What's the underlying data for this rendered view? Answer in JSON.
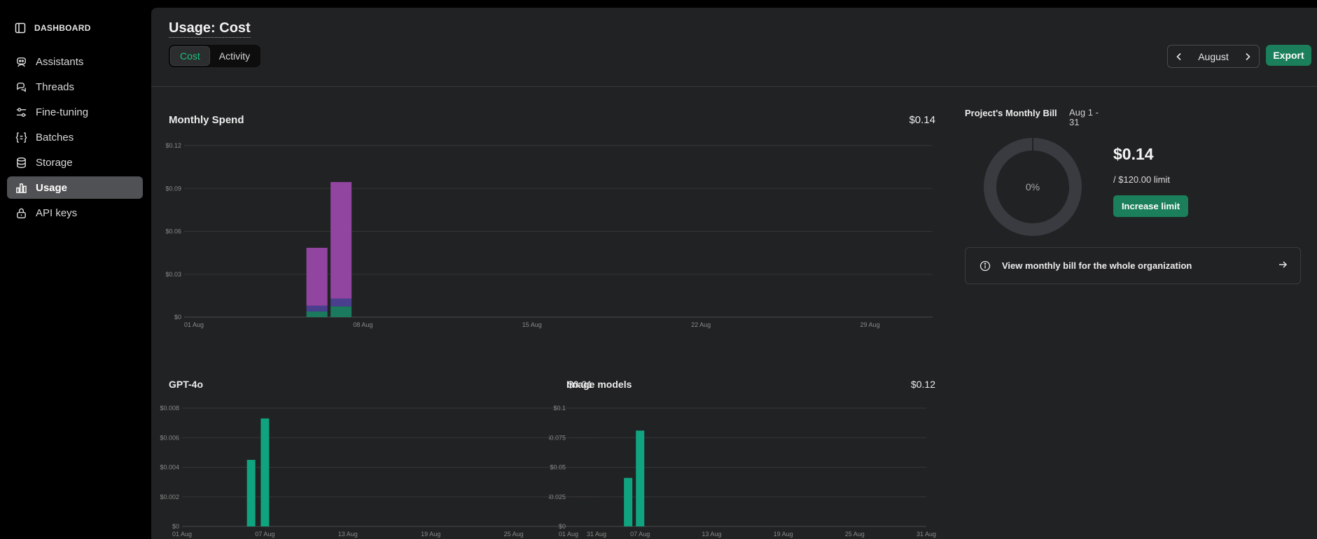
{
  "sidebar": {
    "brand": "DASHBOARD",
    "items": [
      {
        "label": "Assistants",
        "icon": "assistant-icon"
      },
      {
        "label": "Threads",
        "icon": "threads-icon"
      },
      {
        "label": "Fine-tuning",
        "icon": "sliders-icon"
      },
      {
        "label": "Batches",
        "icon": "batches-icon"
      },
      {
        "label": "Storage",
        "icon": "database-icon"
      },
      {
        "label": "Usage",
        "icon": "bar-chart-icon",
        "active": true
      },
      {
        "label": "API keys",
        "icon": "lock-icon"
      }
    ]
  },
  "header": {
    "title": "Usage: Cost",
    "tabs": [
      {
        "label": "Cost",
        "active": true
      },
      {
        "label": "Activity"
      }
    ],
    "month": "August",
    "export_label": "Export"
  },
  "monthly_spend": {
    "title": "Monthly Spend",
    "total": "$0.14"
  },
  "gpt4o": {
    "title": "GPT-4o",
    "total": "$0.01"
  },
  "image_models": {
    "title": "Image models",
    "total": "$0.12"
  },
  "bill": {
    "title": "Project's Monthly Bill",
    "range": "Aug 1 - 31",
    "percent_label": "0%",
    "amount": "$0.14",
    "limit": "/ $120.00 limit",
    "increase_label": "Increase limit",
    "org_link": "View monthly bill for the whole organization"
  },
  "colors": {
    "accent": "#19c37d",
    "button_green": "#1a7f5a",
    "purple": "#9245a0",
    "indigo": "#4a3f8f",
    "teal": "#1b7a5e"
  },
  "chart_data": [
    {
      "type": "bar",
      "title": "Monthly Spend",
      "stacked": true,
      "yticks": [
        "$0",
        "$0.03",
        "$0.06",
        "$0.09",
        "$0.12"
      ],
      "ylim": [
        0,
        0.12
      ],
      "xticks": [
        "01 Aug",
        "08 Aug",
        "15 Aug",
        "22 Aug",
        "29 Aug"
      ],
      "xlim": [
        1,
        32
      ],
      "bars": [
        {
          "day": 6.5,
          "segments": [
            {
              "value": 0.004,
              "color": "#1b7a5e"
            },
            {
              "value": 0.004,
              "color": "#4a3f8f"
            },
            {
              "value": 0.0405,
              "color": "#9245a0"
            }
          ]
        },
        {
          "day": 7.5,
          "segments": [
            {
              "value": 0.0075,
              "color": "#1b7a5e"
            },
            {
              "value": 0.0055,
              "color": "#4a3f8f"
            },
            {
              "value": 0.0815,
              "color": "#9245a0"
            }
          ]
        }
      ]
    },
    {
      "type": "bar",
      "title": "GPT-4o",
      "yticks": [
        "$0",
        "$0.002",
        "$0.004",
        "$0.006",
        "$0.008"
      ],
      "ylim": [
        0,
        0.008
      ],
      "xticks": [
        "01 Aug",
        "07 Aug",
        "13 Aug",
        "19 Aug",
        "25 Aug",
        "31 Aug"
      ],
      "xlim": [
        1,
        31
      ],
      "bars": [
        {
          "day": 6.0,
          "value": 0.0045
        },
        {
          "day": 7.0,
          "value": 0.0073
        }
      ],
      "color": "#10a37f"
    },
    {
      "type": "bar",
      "title": "Image models",
      "yticks": [
        "$0",
        "$0.025",
        "$0.05",
        "$0.075",
        "$0.1"
      ],
      "ylim": [
        0,
        0.1
      ],
      "xticks": [
        "01 Aug",
        "07 Aug",
        "13 Aug",
        "19 Aug",
        "25 Aug",
        "31 Aug"
      ],
      "xlim": [
        1,
        31
      ],
      "bars": [
        {
          "day": 6.0,
          "value": 0.041
        },
        {
          "day": 7.0,
          "value": 0.081
        }
      ],
      "color": "#10a37f"
    }
  ]
}
